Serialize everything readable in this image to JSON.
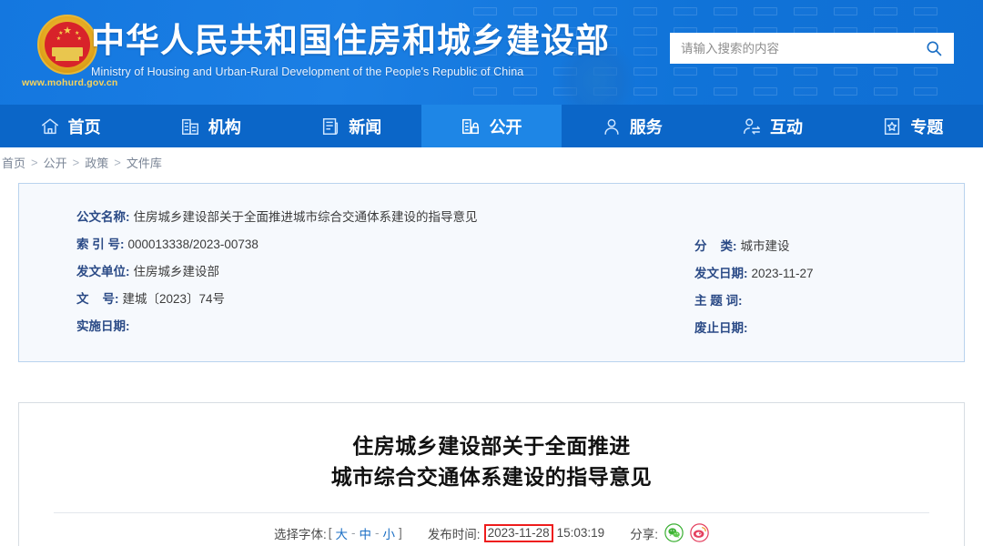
{
  "header": {
    "site_url": "www.mohurd.gov.cn",
    "emblem_icon": "national-emblem-icon",
    "title_cn": "中华人民共和国住房和城乡建设部",
    "title_en": "Ministry of Housing and Urban-Rural Development of the People's Republic of China",
    "search": {
      "placeholder": "请输入搜索的内容",
      "value": "",
      "icon": "search-icon"
    },
    "colors": {
      "bg_start": "#1477df",
      "bg_end": "#0f6fd4",
      "url_color": "#f8d35a"
    }
  },
  "nav": {
    "active_index": 3,
    "bg": "#0b66c8",
    "active_bg": "#1e86e6",
    "items": [
      {
        "label": "首页",
        "icon": "home-icon"
      },
      {
        "label": "机构",
        "icon": "building-icon"
      },
      {
        "label": "新闻",
        "icon": "news-document-icon"
      },
      {
        "label": "公开",
        "icon": "open-disclosure-icon"
      },
      {
        "label": "服务",
        "icon": "user-service-icon"
      },
      {
        "label": "互动",
        "icon": "interaction-icon"
      },
      {
        "label": "专题",
        "icon": "star-topic-icon"
      }
    ]
  },
  "breadcrumb": {
    "items": [
      "首页",
      "公开",
      "政策",
      "文件库"
    ],
    "separator": ">"
  },
  "meta": {
    "left": [
      {
        "label": "公文名称:",
        "value": "住房城乡建设部关于全面推进城市综合交通体系建设的指导意见"
      },
      {
        "label": "索 引 号:",
        "value": "000013338/2023-00738"
      },
      {
        "label": "发文单位:",
        "value": "住房城乡建设部"
      },
      {
        "label": "文    号:",
        "value": "建城〔2023〕74号"
      },
      {
        "label": "实施日期:",
        "value": ""
      }
    ],
    "right": [
      {
        "label": "分    类:",
        "value": "城市建设"
      },
      {
        "label": "发文日期:",
        "value": "2023-11-27"
      },
      {
        "label": "主 题 词:",
        "value": ""
      },
      {
        "label": "废止日期:",
        "value": ""
      }
    ]
  },
  "document": {
    "title_line1": "住房城乡建设部关于全面推进",
    "title_line2": "城市综合交通体系建设的指导意见",
    "font_select": {
      "label": "选择字体:",
      "bracket_open": "[",
      "bracket_close": "]",
      "options": [
        "大",
        "中",
        "小"
      ],
      "separator": "-"
    },
    "publish": {
      "label": "发布时间:",
      "date": "2023-11-28",
      "time": "15:03:19",
      "highlight_color": "#ee1c1c"
    },
    "share": {
      "label": "分享:",
      "items": [
        {
          "name": "wechat-share-icon",
          "color": "#3cb034"
        },
        {
          "name": "weibo-share-icon",
          "color": "#e4405f"
        }
      ]
    }
  }
}
